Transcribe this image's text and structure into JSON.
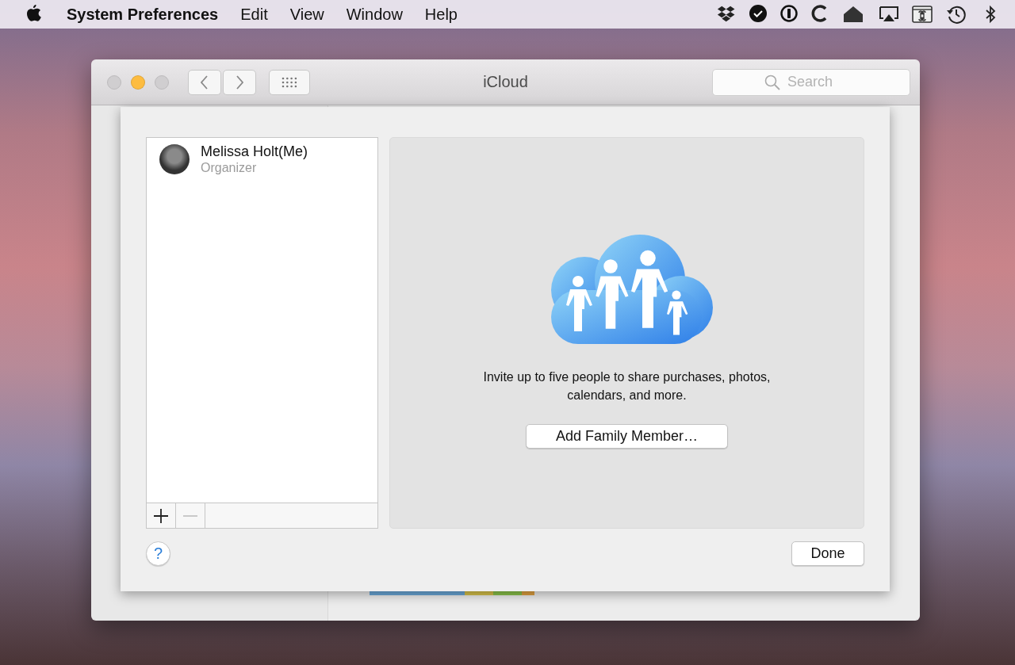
{
  "menu_bar": {
    "app_name": "System Preferences",
    "menus": [
      "Edit",
      "View",
      "Window",
      "Help"
    ]
  },
  "window": {
    "title": "iCloud",
    "traffic_lights": [
      {
        "kind": "close",
        "disabled": true
      },
      {
        "kind": "minimize",
        "disabled": false
      },
      {
        "kind": "zoom",
        "disabled": true
      }
    ],
    "search": {
      "placeholder": "Search"
    }
  },
  "sheet": {
    "members": [
      {
        "name": "Melissa Holt(Me)",
        "role": "Organizer",
        "selected": false
      }
    ],
    "list_controls": [
      {
        "kind": "add",
        "disabled": false
      },
      {
        "kind": "remove",
        "disabled": true
      }
    ],
    "invite_text": "Invite up to five people to share purchases, photos, calendars, and more.",
    "add_button": "Add Family Member…",
    "help_button": "?",
    "done_button": "Done"
  }
}
